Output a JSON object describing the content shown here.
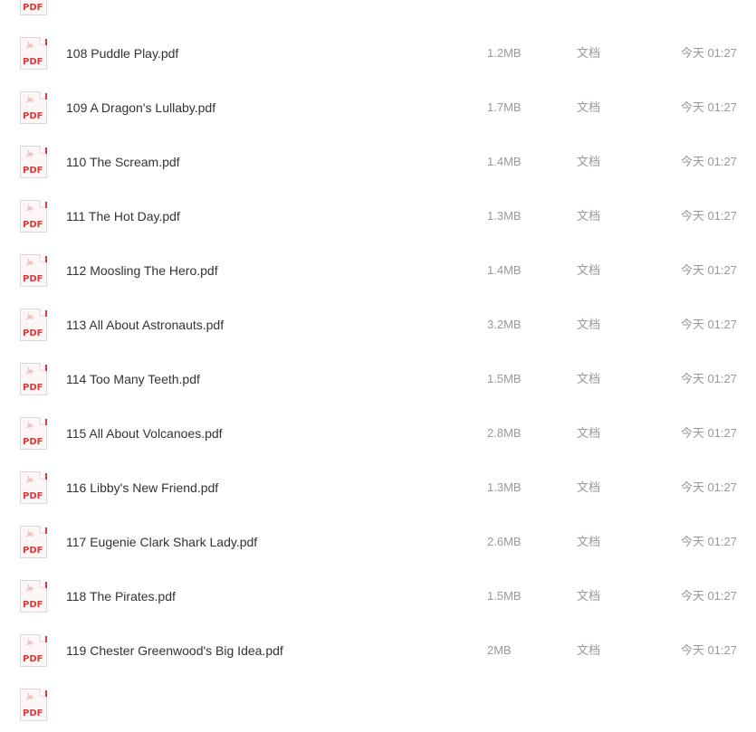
{
  "icon_label": "PDF",
  "colors": {
    "pdf_red": "#d93a3a",
    "name_text": "#333333",
    "meta_text": "#999999"
  },
  "files": [
    {
      "name": "",
      "size": "",
      "type": "",
      "time": ""
    },
    {
      "name": "108 Puddle Play.pdf",
      "size": "1.2MB",
      "type": "文档",
      "time": "今天 01:27"
    },
    {
      "name": "109 A Dragon's Lullaby.pdf",
      "size": "1.7MB",
      "type": "文档",
      "time": "今天 01:27"
    },
    {
      "name": "110 The Scream.pdf",
      "size": "1.4MB",
      "type": "文档",
      "time": "今天 01:27"
    },
    {
      "name": "111 The Hot Day.pdf",
      "size": "1.3MB",
      "type": "文档",
      "time": "今天 01:27"
    },
    {
      "name": "112 Moosling The Hero.pdf",
      "size": "1.4MB",
      "type": "文档",
      "time": "今天 01:27"
    },
    {
      "name": "113 All About Astronauts.pdf",
      "size": "3.2MB",
      "type": "文档",
      "time": "今天 01:27"
    },
    {
      "name": "114 Too Many Teeth.pdf",
      "size": "1.5MB",
      "type": "文档",
      "time": "今天 01:27"
    },
    {
      "name": "115 All About Volcanoes.pdf",
      "size": "2.8MB",
      "type": "文档",
      "time": "今天 01:27"
    },
    {
      "name": "116 Libby's New Friend.pdf",
      "size": "1.3MB",
      "type": "文档",
      "time": "今天 01:27"
    },
    {
      "name": "117 Eugenie Clark Shark Lady.pdf",
      "size": "2.6MB",
      "type": "文档",
      "time": "今天 01:27"
    },
    {
      "name": "118 The Pirates.pdf",
      "size": "1.5MB",
      "type": "文档",
      "time": "今天 01:27"
    },
    {
      "name": "119 Chester Greenwood's Big Idea.pdf",
      "size": "2MB",
      "type": "文档",
      "time": "今天 01:27"
    },
    {
      "name": "",
      "size": "",
      "type": "",
      "time": ""
    }
  ]
}
